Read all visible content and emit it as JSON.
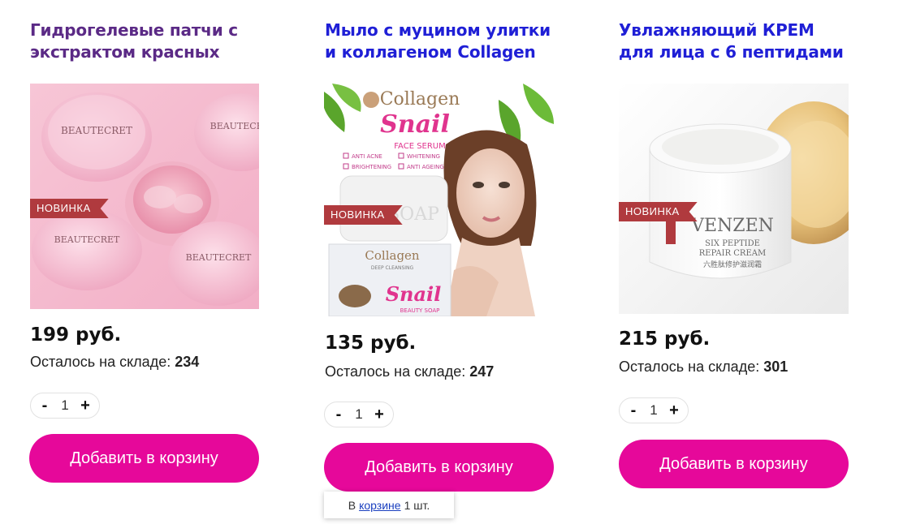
{
  "products": [
    {
      "title": "Гидрогелевые патчи с экстрактом красных",
      "badge": "НОВИНКА",
      "image_brand_text": "BEAUTECRET",
      "price": "199 руб.",
      "stock_label": "Осталось на складе:",
      "stock_value": "234",
      "quantity": "1",
      "minus": "-",
      "plus": "+",
      "add_to_cart": "Добавить в корзину"
    },
    {
      "title": "Мыло с муцином улитки и коллагеном Collagen Snail,",
      "badge": "НОВИНКА",
      "image_text": {
        "collagen": "Collagen",
        "snail": "Snail",
        "face_serum": "FACE SERUM",
        "anti_acne": "ANTI ACNE",
        "whitening": "WHITENING",
        "brightening": "BRIGHTENING",
        "anti_ageing": "ANTI AGEING",
        "soap": "SOAP",
        "deep_cleansing": "DEEP CLEANSING",
        "beauty_soap": "BEAUTY SOAP"
      },
      "price": "135 руб.",
      "stock_label": "Осталось на складе:",
      "stock_value": "247",
      "quantity": "1",
      "minus": "-",
      "plus": "+",
      "add_to_cart": "Добавить в корзину"
    },
    {
      "title": "Увлажняющий КРЕМ для лица с 6 пептидами",
      "badge": "НОВИНКА",
      "image_text": {
        "brand": "VENZEN",
        "line1": "SIX PEPTIDE",
        "line2": "REPAIR CREAM",
        "line3": "六胜肽修护滋润霜"
      },
      "price": "215 руб.",
      "stock_label": "Осталось на складе:",
      "stock_value": "301",
      "quantity": "1",
      "minus": "-",
      "plus": "+",
      "add_to_cart": "Добавить в корзину"
    }
  ],
  "cart_note": {
    "prefix": "В",
    "link": "корзине",
    "suffix": "1 шт."
  },
  "colors": {
    "button": "#e6089a",
    "badge": "#b03a3e",
    "title_purple": "#5b2a86",
    "title_blue": "#1f1fd6"
  }
}
